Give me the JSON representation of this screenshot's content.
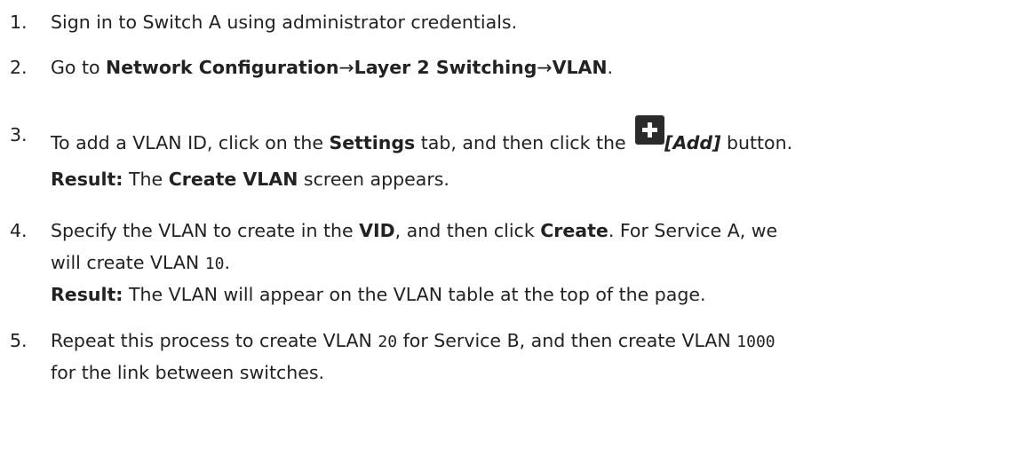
{
  "steps": [
    {
      "num": "1.",
      "text": "Sign in to Switch A using administrator credentials."
    },
    {
      "num": "2.",
      "prefix": "Go to ",
      "path1": "Network Configuration",
      "arrow1": "→",
      "path2": "Layer 2 Switching",
      "arrow2": "→",
      "path3": "VLAN",
      "suffix": "."
    },
    {
      "num": "3.",
      "prefix": "To add a VLAN ID, click on the ",
      "tab": "Settings",
      "middle": " tab, and then click the ",
      "icon": "plus-icon",
      "button": "[Add]",
      "suffix": " button.",
      "result_label": "Result:",
      "result_prefix": " The ",
      "result_screen": "Create VLAN",
      "result_suffix": " screen appears."
    },
    {
      "num": "4.",
      "prefix": "Specify the VLAN to create in the ",
      "field": "VID",
      "middle": ", and then click ",
      "action": "Create",
      "suffix": ". For Service A, we",
      "line2_prefix": "will create VLAN ",
      "line2_code": "10",
      "line2_suffix": ".",
      "result_label": "Result:",
      "result_text": " The VLAN will appear on the VLAN table at the top of the page."
    },
    {
      "num": "5.",
      "prefix": "Repeat this process to create VLAN ",
      "code1": "20",
      "middle": " for Service B, and then create VLAN ",
      "code2": "1000",
      "line2": "for the link between switches."
    }
  ]
}
